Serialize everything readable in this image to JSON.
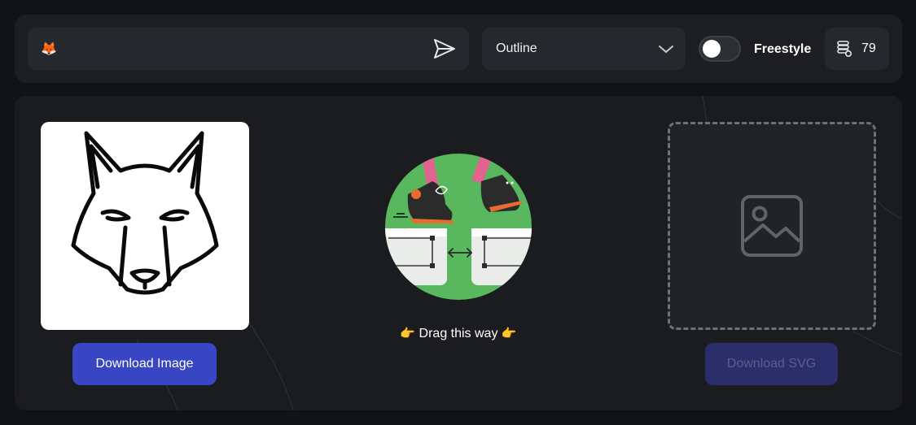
{
  "toolbar": {
    "prompt": {
      "value": "🦊",
      "send_icon": "send-icon"
    },
    "style_select": {
      "selected": "Outline",
      "icon": "chevron-down-icon"
    },
    "freestyle_toggle": {
      "label": "Freestyle",
      "on": false
    },
    "credits": {
      "icon": "coin-stack-icon",
      "count": "79"
    }
  },
  "main": {
    "result": {
      "download_image_label": "Download Image"
    },
    "center": {
      "hand_left": "👉",
      "hint": "Drag this way",
      "hand_right": "👉"
    },
    "svg_output": {
      "placeholder_icon": "image-placeholder-icon",
      "download_svg_label": "Download SVG",
      "download_enabled": false
    }
  },
  "colors": {
    "background": "#121315",
    "panel": "#1b1c1f",
    "field": "#25282c",
    "accent": "#3946c4",
    "accent_disabled": "#2a2f6b"
  }
}
